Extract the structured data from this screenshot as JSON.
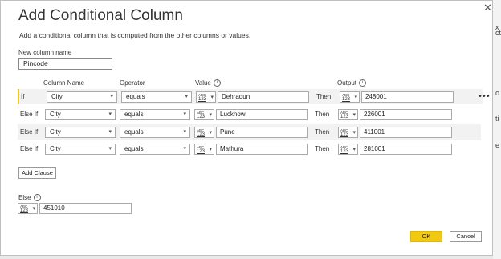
{
  "dialog": {
    "title": "Add Conditional Column",
    "subtitle": "Add a conditional column that is computed from the other columns or values.",
    "close_glyph": "✕"
  },
  "new_column": {
    "label": "New column name",
    "value": "Pincode"
  },
  "headers": {
    "column_name": "Column Name",
    "operator": "Operator",
    "value": "Value",
    "output": "Output",
    "info_glyph": "i"
  },
  "type_icon": {
    "top": "ABC",
    "bottom": "123",
    "arrow": "▾"
  },
  "dropdown_arrow": "▾",
  "clauses": [
    {
      "keyword": "If",
      "column": "City",
      "operator": "equals",
      "value": "Dehradun",
      "then": "Then",
      "output": "248001"
    },
    {
      "keyword": "Else If",
      "column": "City",
      "operator": "equals",
      "value": "Lucknow",
      "then": "Then",
      "output": "226001"
    },
    {
      "keyword": "Else If",
      "column": "City",
      "operator": "equals",
      "value": "Pune",
      "then": "Then",
      "output": "411001"
    },
    {
      "keyword": "Else If",
      "column": "City",
      "operator": "equals",
      "value": "Mathura",
      "then": "Then",
      "output": "281001"
    }
  ],
  "more_glyph": "•••",
  "add_clause_label": "Add Clause",
  "else": {
    "label": "Else",
    "value": "451010"
  },
  "buttons": {
    "ok": "OK",
    "cancel": "Cancel"
  },
  "edge_chars": [
    "x",
    "ct",
    "o",
    "ti",
    "e"
  ],
  "colors": {
    "accent": "#f2c811",
    "highlight_row": "#f2f2f2"
  }
}
